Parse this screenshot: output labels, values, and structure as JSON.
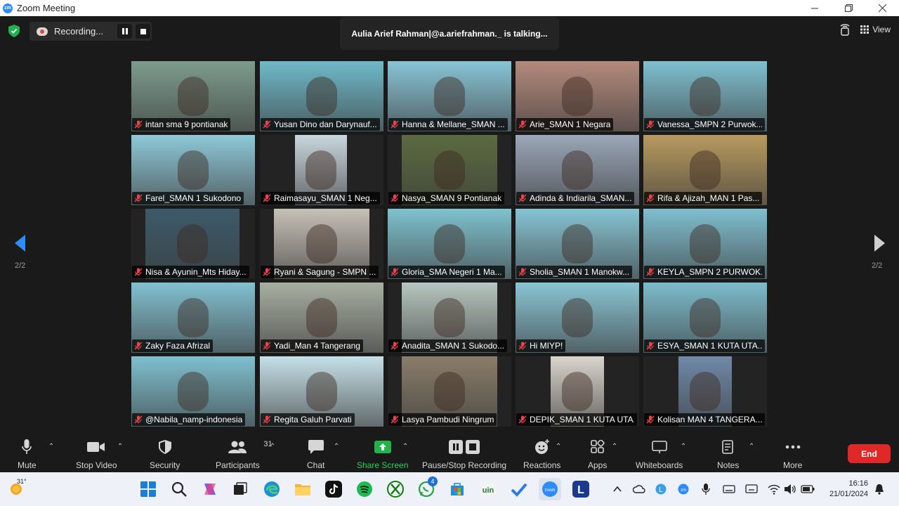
{
  "window": {
    "title": "Zoom Meeting"
  },
  "recording": {
    "label": "Recording..."
  },
  "talking": {
    "text": "Aulia Arief Rahman|@a.ariefrahman._ is talking..."
  },
  "view": {
    "label": "View"
  },
  "pager": {
    "left": "2/2",
    "right": "2/2"
  },
  "participants": [
    {
      "name": "intan sma 9 pontianak",
      "bg": "#7d9c8e"
    },
    {
      "name": "Yusan Dino dan Darynauf...",
      "bg": "#6fb9c9"
    },
    {
      "name": "Hanna & Mellane_SMAN ...",
      "bg": "#88c4d6"
    },
    {
      "name": "Arie_SMAN 1 Negara",
      "bg": "#b48a7c"
    },
    {
      "name": "Vanessa_SMPN 2 Purwok...",
      "bg": "#7fc0d0"
    },
    {
      "name": "Farel_SMAN 1 Sukodono",
      "bg": "#8ec9d8"
    },
    {
      "name": "Raimasayu_SMAN 1 Neg...",
      "bg": "#c9d7de"
    },
    {
      "name": "Nasya_SMAN 9 Pontianak",
      "bg": "#5b6b3f"
    },
    {
      "name": "Adinda & Indiarila_SMAN...",
      "bg": "#9aa7b8"
    },
    {
      "name": "Rifa & Ajizah_MAN 1 Pas...",
      "bg": "#b89a5f"
    },
    {
      "name": "Nisa & Ayunin_Mts Hiday...",
      "bg": "#3c5a6a"
    },
    {
      "name": "Ryani & Sagung - SMPN ...",
      "bg": "#c6c0b6"
    },
    {
      "name": "Gloria_SMA Negeri 1 Ma...",
      "bg": "#7fc2cf"
    },
    {
      "name": "Sholia_SMAN 1 Manokw...",
      "bg": "#86c4d3"
    },
    {
      "name": "KEYLA_SMPN 2 PURWOK...",
      "bg": "#7fbfcf"
    },
    {
      "name": "Zaky Faza Afrizal",
      "bg": "#82c1d1"
    },
    {
      "name": "Yadi_Man 4 Tangerang",
      "bg": "#a8afa2"
    },
    {
      "name": "Anadita_SMAN 1 Sukodo...",
      "bg": "#b7c6c0"
    },
    {
      "name": "Hi MIYP!",
      "bg": "#8ac5d4"
    },
    {
      "name": "ESYA_SMAN 1 KUTA UTA...",
      "bg": "#7dbccc"
    },
    {
      "name": "@Nabila_namp-indonesia",
      "bg": "#7fc0cf"
    },
    {
      "name": "Regita Galuh Parvati",
      "bg": "#c5e1e8"
    },
    {
      "name": "Lasya Pambudi Ningrum",
      "bg": "#8a7d6a"
    },
    {
      "name": "DEPIK_SMAN 1 KUTA UTA...",
      "bg": "#d9d5cc"
    },
    {
      "name": "Kolisan MAN 4 TANGERA...",
      "bg": "#6f8aa8"
    }
  ],
  "toolbar": {
    "mute": "Mute",
    "stop_video": "Stop Video",
    "security": "Security",
    "participants": "Participants",
    "participants_count": "31",
    "chat": "Chat",
    "share_screen": "Share Screen",
    "recording": "Pause/Stop Recording",
    "reactions": "Reactions",
    "apps": "Apps",
    "whiteboards": "Whiteboards",
    "notes": "Notes",
    "more": "More",
    "end": "End"
  },
  "taskbar": {
    "temperature": "31°",
    "time": "16:16",
    "date": "21/01/2024",
    "whatsapp_badge": "4"
  },
  "colors": {
    "accent": "#2d8cff",
    "share": "#24b24b",
    "end": "#e02828",
    "muted_mic": "#e5454b"
  }
}
